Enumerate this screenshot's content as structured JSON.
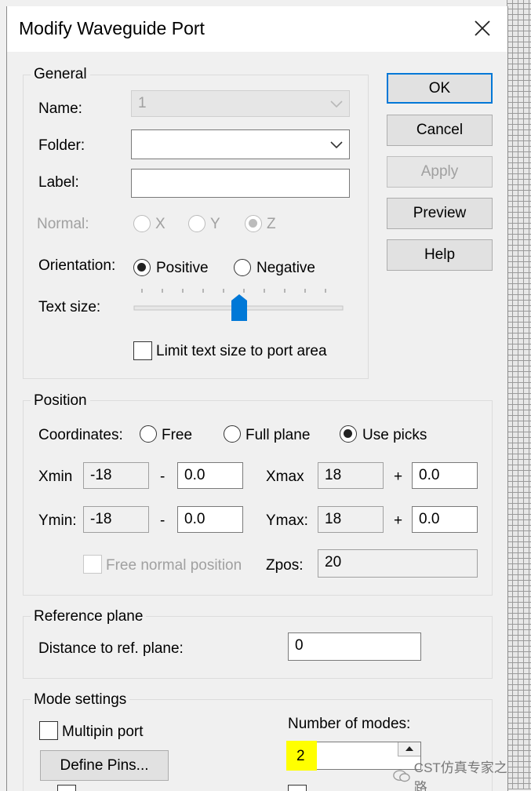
{
  "dialog": {
    "title": "Modify Waveguide Port"
  },
  "general": {
    "legend": "General",
    "name_label": "Name:",
    "name_value": "1",
    "folder_label": "Folder:",
    "folder_value": "",
    "label_label": "Label:",
    "label_value": "",
    "normal_label": "Normal:",
    "normal_options": [
      "X",
      "Y",
      "Z"
    ],
    "normal_selected": "Z",
    "orientation_label": "Orientation:",
    "orientation_options": [
      "Positive",
      "Negative"
    ],
    "orientation_selected": "Positive",
    "text_size_label": "Text size:",
    "text_size_level": 0.5,
    "limit_label": "Limit text size to port area",
    "limit_checked": false
  },
  "buttons": {
    "ok": "OK",
    "cancel": "Cancel",
    "apply": "Apply",
    "preview": "Preview",
    "help": "Help"
  },
  "position": {
    "legend": "Position",
    "coordinates_label": "Coordinates:",
    "coordinate_options": [
      "Free",
      "Full plane",
      "Use picks"
    ],
    "coordinate_selected": "Use picks",
    "xmin_label": "Xmin",
    "xmin_value": "-18",
    "xmin_offset": "0.0",
    "xmax_label": "Xmax",
    "xmax_value": "18",
    "xmax_offset": "0.0",
    "ymin_label": "Ymin:",
    "ymin_value": "-18",
    "ymin_offset": "0.0",
    "ymax_label": "Ymax:",
    "ymax_value": "18",
    "ymax_offset": "0.0",
    "minus": "-",
    "plus": "+",
    "free_normal_label": "Free normal position",
    "zpos_label": "Zpos:",
    "zpos_value": "20"
  },
  "reference": {
    "legend": "Reference plane",
    "distance_label": "Distance to ref. plane:",
    "distance_value": "0"
  },
  "mode": {
    "legend": "Mode settings",
    "multipin_label": "Multipin port",
    "define_pins": "Define Pins...",
    "num_modes_label": "Number of modes:",
    "num_modes_value": "2"
  },
  "watermark": "CST仿真专家之路",
  "colors": {
    "accent": "#0078d7",
    "highlight": "#ffff00"
  }
}
